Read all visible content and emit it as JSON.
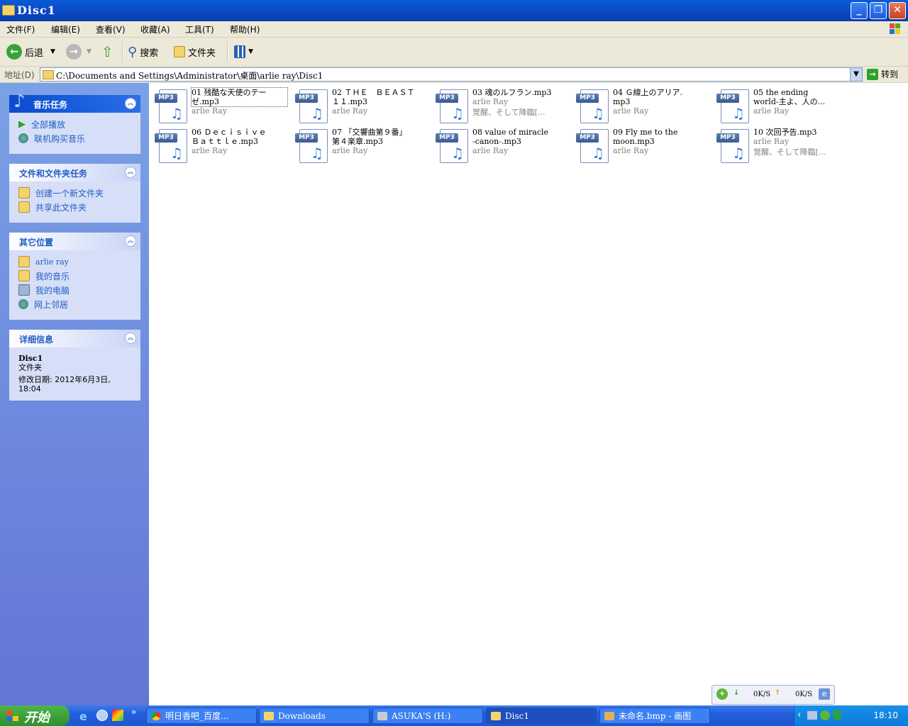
{
  "window": {
    "title": "Disc1"
  },
  "menu": [
    "文件(F)",
    "编辑(E)",
    "查看(V)",
    "收藏(A)",
    "工具(T)",
    "帮助(H)"
  ],
  "toolbar": {
    "back": "后退",
    "search": "搜索",
    "folders": "文件夹"
  },
  "address": {
    "label": "地址(D)",
    "path": "C:\\Documents and Settings\\Administrator\\桌面\\arlie ray\\Disc1",
    "go": "转到"
  },
  "music_tasks": {
    "title": "音乐任务",
    "items": [
      "全部播放",
      "联机购买音乐"
    ]
  },
  "file_tasks": {
    "title": "文件和文件夹任务",
    "items": [
      "创建一个新文件夹",
      "共享此文件夹"
    ]
  },
  "other_places": {
    "title": "其它位置",
    "items": [
      "arlie ray",
      "我的音乐",
      "我的电脑",
      "网上邻居"
    ]
  },
  "details": {
    "title": "详细信息",
    "name": "Disc1",
    "type": "文件夹",
    "modified": "修改日期: 2012年6月3日,\n18:04"
  },
  "files": [
    {
      "name": "01 残酷な天使のテー\nゼ.mp3",
      "artist": "arlie Ray",
      "album": ""
    },
    {
      "name": "02 ＴＨＥ　ＢＥＡＳＴ\n１１.mp3",
      "artist": "arlie Ray",
      "album": ""
    },
    {
      "name": "03 魂のルフラン.mp3",
      "artist": "arlie Ray",
      "album": "覚醒、そして降臨[..."
    },
    {
      "name": "04 Ｇ線上のアリア.\nmp3",
      "artist": "arlie Ray",
      "album": ""
    },
    {
      "name": "05 the ending\nworld-主よ、人の...",
      "artist": "arlie Ray",
      "album": ""
    },
    {
      "name": "06 Ｄｅｃｉｓｉｖｅ\nＢａｔｔｌｅ.mp3",
      "artist": "arlie Ray",
      "album": ""
    },
    {
      "name": "07 「交響曲第９番」\n第４楽章.mp3",
      "artist": "arlie Ray",
      "album": ""
    },
    {
      "name": "08 value of miracle\n-canon-.mp3",
      "artist": "arlie Ray",
      "album": ""
    },
    {
      "name": "09 Fly me to the\nmoon.mp3",
      "artist": "arlie Ray",
      "album": ""
    },
    {
      "name": "10 次回予告.mp3",
      "artist": "arlie Ray",
      "album": "覚醒、そして降臨[..."
    }
  ],
  "icon_tag": "MP3",
  "net": {
    "down": "0K/S",
    "up": "0K/S"
  },
  "taskbar": {
    "start": "开始",
    "tasks": [
      "明日香吧_百度...",
      "Downloads",
      "ASUKA'S (H:)",
      "Disc1",
      "未命名.bmp - 画图"
    ],
    "clock": "18:10"
  }
}
